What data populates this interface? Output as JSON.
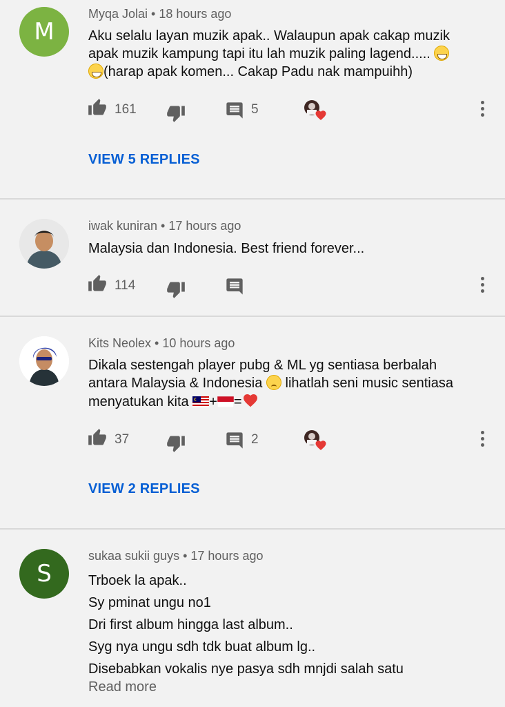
{
  "comments": [
    {
      "author": "Myqa Jolai",
      "time": "18 hours ago",
      "avatar_letter": "M",
      "avatar_color": "#7cb342",
      "lines": [
        "Aku selalu layan muzik apak.. Walaupun apak cakap muzik",
        "apak muzik kampung tapi itu lah muzik paling lagend.....",
        "(harap apak komen... Cakap Padu nak mampuihh)"
      ],
      "likes": "161",
      "replies_count": "5",
      "view_replies": "VIEW 5 REPLIES"
    },
    {
      "author": "iwak kuniran",
      "time": "17 hours ago",
      "lines": [
        "Malaysia dan Indonesia. Best friend forever..."
      ],
      "likes": "114"
    },
    {
      "author": "Kits Neolex",
      "time": "10 hours ago",
      "lines": [
        "Dikala sestengah player pubg & ML yg sentiasa berbalah",
        "antara Malaysia & Indonesia",
        "lihatlah seni music sentiasa",
        "menyatukan kita",
        "+",
        "="
      ],
      "likes": "37",
      "replies_count": "2",
      "view_replies": "VIEW 2 REPLIES"
    },
    {
      "author": "sukaa sukii guys",
      "time": "17 hours ago",
      "avatar_letter": "S",
      "avatar_color": "#33691e",
      "lines": [
        "Trboek la apak..",
        "Sy pminat ungu no1",
        "Dri first album hingga last album..",
        "Syg nya ungu sdh tdk buat album lg..",
        "Disebabkan vokalis nye pasya sdh mnjdi salah satu"
      ],
      "read_more": "Read more"
    }
  ],
  "separator": " • ",
  "colors": {
    "background": "#f2f2f2",
    "link_blue": "#065fd4",
    "secondary_text": "#606060",
    "heart_red": "#e53935"
  },
  "icons": {
    "like": "thumb-up-icon",
    "dislike": "thumb-down-icon",
    "reply": "comment-icon",
    "more": "more-vert-icon",
    "creator_heart": "creator-heart-icon"
  }
}
